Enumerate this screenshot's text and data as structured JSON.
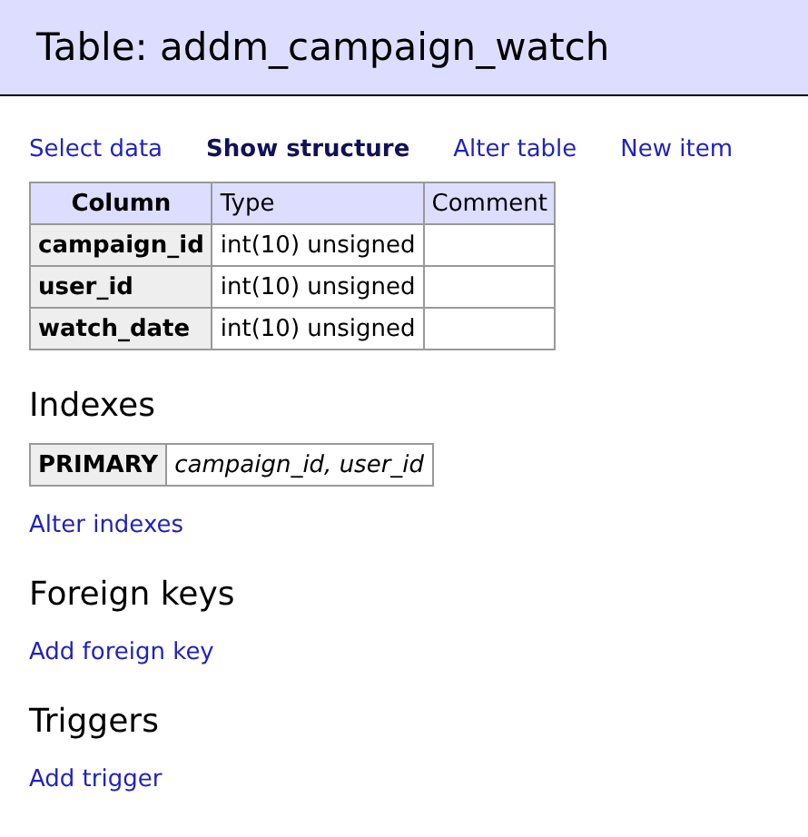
{
  "title": "Table: addm_campaign_watch",
  "links": [
    {
      "label": "Select data",
      "selected": false
    },
    {
      "label": "Show structure",
      "selected": true
    },
    {
      "label": "Alter table",
      "selected": false
    },
    {
      "label": "New item",
      "selected": false
    }
  ],
  "columns_table": {
    "columns": [
      "Column",
      "Type",
      "Comment"
    ],
    "rows": [
      [
        "campaign_id",
        "int(10) unsigned",
        ""
      ],
      [
        "user_id",
        "int(10) unsigned",
        ""
      ],
      [
        "watch_date",
        "int(10) unsigned",
        ""
      ]
    ]
  },
  "sections": [
    {
      "heading": "Indexes",
      "indexes": [
        {
          "type": "PRIMARY",
          "columns": "campaign_id, user_id"
        }
      ],
      "link": "Alter indexes"
    },
    {
      "heading": "Foreign keys",
      "link": "Add foreign key"
    },
    {
      "heading": "Triggers",
      "link": "Add trigger"
    }
  ]
}
